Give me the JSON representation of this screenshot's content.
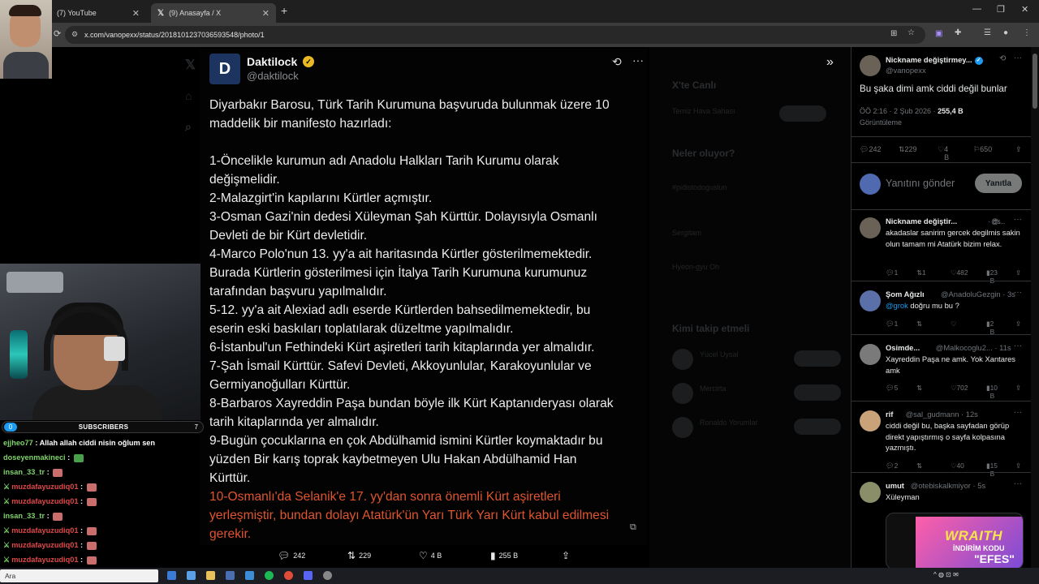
{
  "browser": {
    "tabs": [
      {
        "label": "(7) YouTube"
      },
      {
        "label": "(9) Anasayfa / X"
      }
    ],
    "new_tab": "+",
    "url": "x.com/vanopexx/status/2018101237036593548/photo/1",
    "window_controls": {
      "minimize": "—",
      "restore": "❐",
      "close": "✕"
    }
  },
  "background_page": {
    "live_title": "X'te Canlı",
    "live_sub": "Temiz Hava Sahası",
    "trends_title": "Neler oluyor?",
    "trend_1": "#pidistodoguslun",
    "trend_2": "Sergitam",
    "trend_3": "Hyeon-gyu Oh",
    "follow_title": "Kimi takip etmeli",
    "follow_1": "Yücel Uysal",
    "follow_2": "Mercirta",
    "follow_3": "Ronaldo Yorumlar"
  },
  "tweet_image": {
    "avatar_letter": "D",
    "author_name": "Daktilock",
    "author_handle": "@daktilock",
    "lines": [
      {
        "text": "Diyarbakır Barosu, Türk Tarih Kurumuna başvuruda bulunmak üzere 10",
        "red": false
      },
      {
        "text": "maddelik bir manifesto hazırladı:",
        "red": false
      },
      {
        "text": "",
        "red": false
      },
      {
        "text": "1-Öncelikle kurumun adı Anadolu Halkları Tarih Kurumu olarak",
        "red": false
      },
      {
        "text": "değişmelidir.",
        "red": false
      },
      {
        "text": "2-Malazgirt'in kapılarını Kürtler açmıştır.",
        "red": false
      },
      {
        "text": "3-Osman Gazi'nin dedesi Xüleyman Şah Kürttür. Dolayısıyla Osmanlı",
        "red": false
      },
      {
        "text": "Devleti de bir Kürt devletidir.",
        "red": false
      },
      {
        "text": "4-Marco Polo'nun 13. yy'a ait haritasında Kürtler gösterilmemektedir.",
        "red": false
      },
      {
        "text": "Burada Kürtlerin gösterilmesi için İtalya Tarih Kurumuna kurumunuz",
        "red": false
      },
      {
        "text": "tarafından başvuru yapılmalıdır.",
        "red": false
      },
      {
        "text": "5-12. yy'a ait Alexiad adlı eserde Kürtlerden bahsedilmemektedir, bu",
        "red": false
      },
      {
        "text": "eserin eski baskıları toplatılarak düzeltme yapılmalıdır.",
        "red": false
      },
      {
        "text": "6-İstanbul'un Fethindeki Kürt aşiretleri tarih kitaplarında yer almalıdır.",
        "red": false
      },
      {
        "text": "7-Şah İsmail Kürttür. Safevi Devleti, Akkoyunlular, Karakoyunlular ve",
        "red": false
      },
      {
        "text": "Germiyanoğulları Kürttür.",
        "red": false
      },
      {
        "text": "8-Barbaros Xayreddin Paşa bundan böyle ilk Kürt Kaptanıderyası olarak",
        "red": false
      },
      {
        "text": "tarih kitaplarında yer almalıdır.",
        "red": false
      },
      {
        "text": "9-Bugün çocuklarına en çok Abdülhamid ismini Kürtler koymaktadır bu",
        "red": false
      },
      {
        "text": "yüzden Bir karış toprak kaybetmeyen Ulu Hakan Abdülhamid Han",
        "red": false
      },
      {
        "text": "Kürttür.",
        "red": false
      },
      {
        "text": "10-Osmanlı'da Selanik'e 17. yy'dan sonra önemli Kürt aşiretleri",
        "red": true
      },
      {
        "text": "yerleşmiştir, bundan dolayı Atatürk'ün Yarı Türk Yarı Kürt kabul edilmesi",
        "red": true
      },
      {
        "text": "gerekir.",
        "red": true
      }
    ]
  },
  "bottom_actions": {
    "replies": "242",
    "reposts": "229",
    "likes": "4 B",
    "views": "255 B"
  },
  "right_panel": {
    "main": {
      "name": "Nickname değiştirmey...",
      "handle": "@vanopexx",
      "text": "Bu şaka dimi amk ciddi değil bunlar",
      "time": "ÖÖ 2:16 · 2 Şub 2026 · ",
      "views_count": "255,4 B",
      "views_label": "Görüntüleme",
      "stats": {
        "replies": "242",
        "reposts": "229",
        "likes": "4 B",
        "bookmarks": "650"
      },
      "reply_placeholder": "Yanıtını gönder",
      "reply_button": "Yanıtla"
    },
    "replies": [
      {
        "name": "Nickname değiştir...",
        "handle": "@...",
        "time": "· 8s",
        "text": "akadaslar sanirim gercek degilmis sakin olun tamam mi Atatürk bizim relax.",
        "stats": {
          "replies": "1",
          "reposts": "1",
          "likes": "482",
          "views": "23 B"
        },
        "avatar_color": "#6b6257"
      },
      {
        "name": "Şom Ağızlı",
        "handle": "@AnadoluGezgin · 3s",
        "mention": "@grok",
        "text": " doğru mu bu ?",
        "stats": {
          "replies": "1",
          "reposts": "",
          "likes": "",
          "views": "2 B"
        },
        "avatar_color": "#5b6fa8"
      },
      {
        "name": "Osimde...",
        "handle": "@Malkocoglu2... · 11s",
        "text": "Xayreddin Paşa ne amk. Yok Xantares amk",
        "stats": {
          "replies": "5",
          "reposts": "",
          "likes": "702",
          "views": "10 B"
        },
        "avatar_color": "#7a7a7a"
      },
      {
        "name": "rif",
        "handle": "@sal_gudmann · 12s",
        "text": "ciddi değil bu, başka sayfadan görüp direkt yapıştırmış o sayfa kolpasına yazmıştı.",
        "stats": {
          "replies": "2",
          "reposts": "",
          "likes": "40",
          "views": "15 B"
        },
        "avatar_color": "#c9a27a"
      },
      {
        "name": "umut",
        "handle": "@otebiskalkmiyor · 5s",
        "text": "Xüleyman",
        "stats": {
          "replies": "",
          "reposts": "",
          "likes": "",
          "views": ""
        },
        "avatar_color": "#8a8f6a"
      }
    ]
  },
  "ad": {
    "wraith": "WRAITH",
    "code": "İNDİRİM KODU",
    "efes": "\"EFES\""
  },
  "stream": {
    "sub_left": "0",
    "sub_label": "SUBSCRIBERS",
    "sub_right": "7",
    "chat": [
      {
        "user": "ejjheo77",
        "msg": " : Allah allah ciddi nisin oğlum sen",
        "red": false,
        "sword": false,
        "emote": ""
      },
      {
        "user": "doseyenmakineci",
        "msg": " : ",
        "red": false,
        "sword": false,
        "emote": "green"
      },
      {
        "user": "insan_33_tr",
        "msg": " : ",
        "red": false,
        "sword": false,
        "emote": "red"
      },
      {
        "user": "muzdafayuzudiq01",
        "msg": " : ",
        "red": true,
        "sword": true,
        "emote": "red"
      },
      {
        "user": "muzdafayuzudiq01",
        "msg": " : ",
        "red": true,
        "sword": true,
        "emote": "red"
      },
      {
        "user": "insan_33_tr",
        "msg": " : ",
        "red": false,
        "sword": false,
        "emote": "red"
      },
      {
        "user": "muzdafayuzudiq01",
        "msg": " : ",
        "red": true,
        "sword": true,
        "emote": "red"
      },
      {
        "user": "muzdafayuzudiq01",
        "msg": " : ",
        "red": true,
        "sword": true,
        "emote": "red"
      },
      {
        "user": "muzdafayuzudiq01",
        "msg": " : ",
        "red": true,
        "sword": true,
        "emote": "red"
      }
    ]
  },
  "taskbar": {
    "search_text": "Ara",
    "tray": "^  ◍  ⊡  ✉"
  }
}
